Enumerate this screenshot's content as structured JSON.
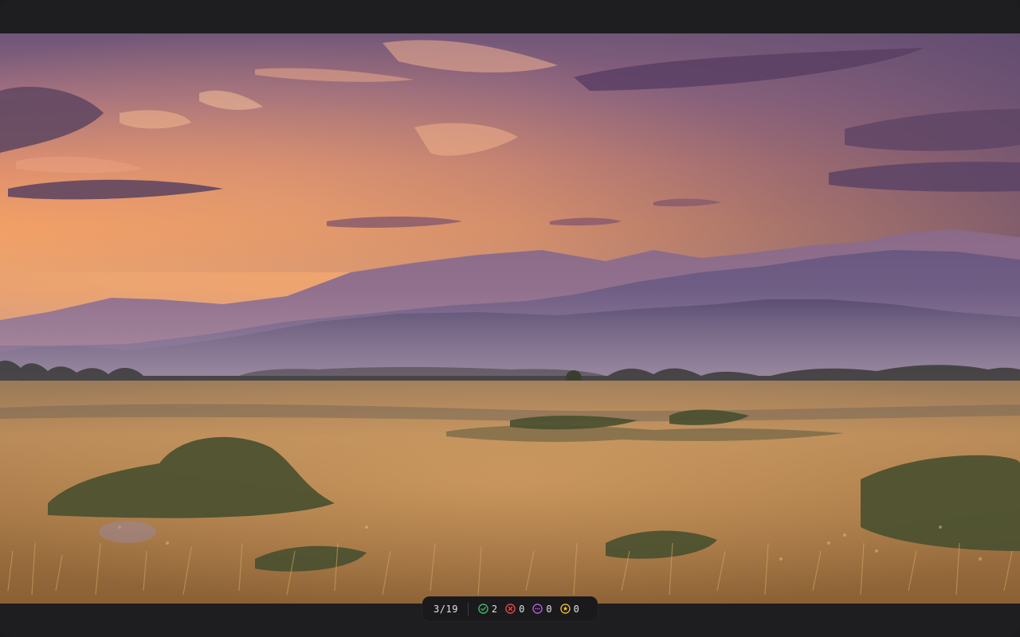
{
  "viewer": {
    "image_alt_icon": "landscape-photo",
    "counter": {
      "current": "3",
      "separator": "/",
      "total": "19"
    },
    "stats": [
      {
        "name": "accepted",
        "icon": "check-circle-icon",
        "count": "2",
        "color": "#3ec46d"
      },
      {
        "name": "rejected",
        "icon": "x-circle-icon",
        "count": "0",
        "color": "#ef4b4b"
      },
      {
        "name": "skipped",
        "icon": "dots-circle-icon",
        "count": "0",
        "color": "#c05cf0"
      },
      {
        "name": "starred",
        "icon": "star-circle-icon",
        "count": "0",
        "color": "#f2c230"
      }
    ]
  }
}
